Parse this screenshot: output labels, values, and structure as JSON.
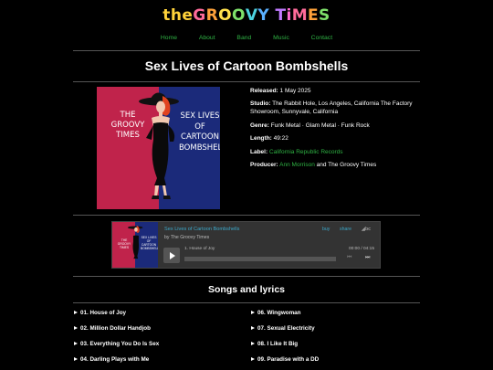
{
  "site": {
    "logo_parts": [
      {
        "text": "the ",
        "color": "#ffd23a"
      },
      {
        "text": "G",
        "color": "#ff6b9a"
      },
      {
        "text": "R",
        "color": "#ffa23a"
      },
      {
        "text": "O",
        "color": "#ffe14d"
      },
      {
        "text": "O",
        "color": "#7ee06a"
      },
      {
        "text": "V",
        "color": "#4dd3e0"
      },
      {
        "text": "Y",
        "color": "#5ab0ff"
      },
      {
        "text": " ",
        "color": "#ffffff"
      },
      {
        "text": "T",
        "color": "#c07aff"
      },
      {
        "text": "i",
        "color": "#ff6bd0"
      },
      {
        "text": "M",
        "color": "#ff6b9a"
      },
      {
        "text": "E",
        "color": "#ffa23a"
      },
      {
        "text": "S",
        "color": "#7ee06a"
      }
    ],
    "nav": [
      "Home",
      "About",
      "Band",
      "Music",
      "Contact"
    ],
    "accent": "#2fb344"
  },
  "album": {
    "title": "Sex Lives of Cartoon Bombshells",
    "cover_left_text": "THE GROOVY TIMES",
    "cover_right_text": "SEX LIVES OF CARTOON BOMBSHELLS",
    "released_label": "Released:",
    "released": "1 May 2025",
    "studio_label": "Studio:",
    "studio": "The Rabbit Hole, Los Angeles, California The Factory Showroom, Sunnyvale, California",
    "genre_label": "Genre:",
    "genre": "Funk Metal · Glam Metal · Funk Rock",
    "length_label": "Length:",
    "length": "49:22",
    "label_label": "Label:",
    "label": "California Republic Records",
    "producer_label": "Producer:",
    "producer_name": "Ann Morrison",
    "producer_rest": "and The Groovy Times"
  },
  "player": {
    "title": "Sex Lives of Cartoon Bombshells",
    "by": "by The Groovy Times",
    "buy": "buy",
    "share": "share",
    "brand": "◢bc",
    "track": "1.   House of Joy",
    "time": "00:00 / 04:15",
    "progress": 0
  },
  "songs": {
    "heading": "Songs and lyrics",
    "left": [
      "01. House of Joy",
      "02. Million Dollar Handjob",
      "03. Everything You Do Is Sex",
      "04. Darling Plays with Me"
    ],
    "right": [
      "06. Wingwoman",
      "07. Sexual Electricity",
      "08. I Like It Big",
      "09. Paradise with a DD"
    ]
  }
}
